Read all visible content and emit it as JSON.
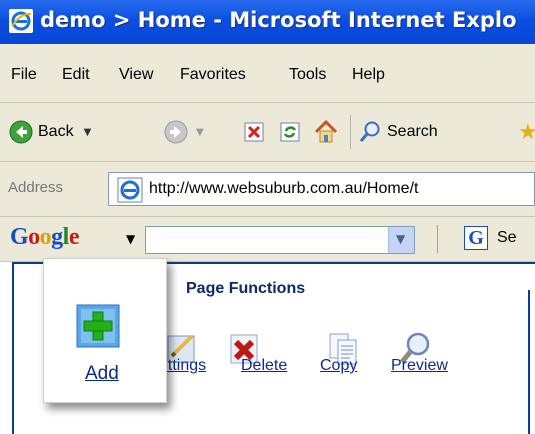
{
  "window": {
    "title": "demo > Home - Microsoft Internet Explo"
  },
  "menu": {
    "items": [
      "File",
      "Edit",
      "View",
      "Favorites",
      "Tools",
      "Help"
    ]
  },
  "toolbar": {
    "back_label": "Back",
    "search_label": "Search"
  },
  "address": {
    "label": "Address",
    "url": "http://www.websuburb.com.au/Home/t"
  },
  "google": {
    "search_label": "Se"
  },
  "page": {
    "panel_title": "Page Functions",
    "functions": [
      "ettings",
      "Delete",
      "Copy",
      "Preview"
    ],
    "zoom_label": "Add"
  },
  "colors": {
    "titlebar": "#0a4fe0",
    "chrome": "#ece9d8",
    "link": "#0b2a8a",
    "border": "#0b3d8f"
  }
}
